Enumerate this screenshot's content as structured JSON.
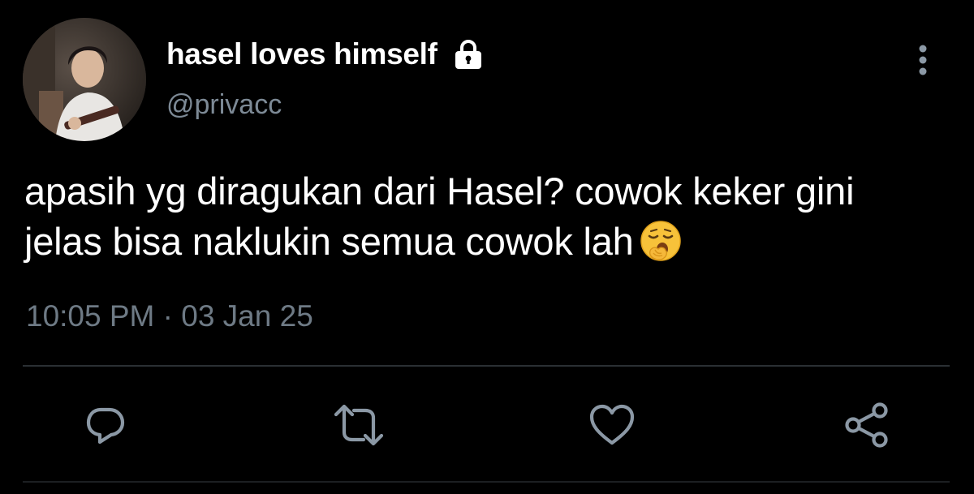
{
  "tweet": {
    "display_name": "hasel loves himself",
    "handle": "@privacc",
    "text": "apasih yg diragukan dari Hasel? cowok keker gini jelas bisa naklukin semua cowok lah",
    "timestamp": "10:05 PM · 03 Jan 25"
  },
  "icons": {
    "lock": "lock-icon",
    "more": "more-vertical-icon",
    "emoji": "yawning-face-emoji",
    "reply": "reply-icon",
    "retweet": "retweet-icon",
    "like": "heart-icon",
    "share": "share-icon"
  },
  "colors": {
    "background": "#000000",
    "primary_text": "#ffffff",
    "secondary_text": "#7d8a96",
    "icon_gray": "#8b98a5",
    "divider": "#2a2f33"
  }
}
